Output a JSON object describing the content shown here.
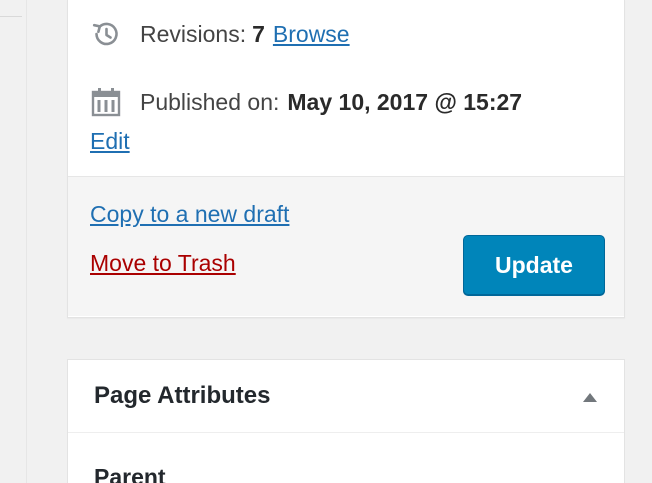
{
  "publish": {
    "revisions": {
      "icon": "history-icon",
      "label": "Revisions:",
      "count": "7",
      "browse_link": "Browse"
    },
    "published": {
      "icon": "calendar-icon",
      "label": "Published on:",
      "date": "May 10, 2017 @ 15:27",
      "edit_link": "Edit"
    },
    "actions": {
      "copy_link": "Copy to a new draft",
      "trash_link": "Move to Trash",
      "update_button": "Update"
    }
  },
  "page_attributes": {
    "title": "Page Attributes",
    "toggle_icon": "triangle-up-icon",
    "parent_label": "Parent"
  },
  "colors": {
    "link": "#1f6fb2",
    "trash": "#a00",
    "primary_button": "#0085ba"
  }
}
